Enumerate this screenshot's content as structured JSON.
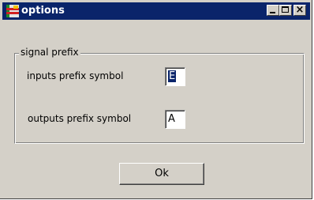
{
  "window": {
    "title": "options",
    "controls": [
      "minimize-icon",
      "maximize-icon",
      "close-icon"
    ],
    "titlebar_color": "#0a246a",
    "face_color": "#d4d0c8"
  },
  "groupbox": {
    "legend": "signal prefix",
    "inputs": {
      "label": "inputs prefix symbol",
      "value": "E"
    },
    "outputs": {
      "label": "outputs prefix symbol",
      "value": "A"
    }
  },
  "footer": {
    "ok_label": "Ok"
  },
  "glyphs": {
    "close": "×"
  }
}
